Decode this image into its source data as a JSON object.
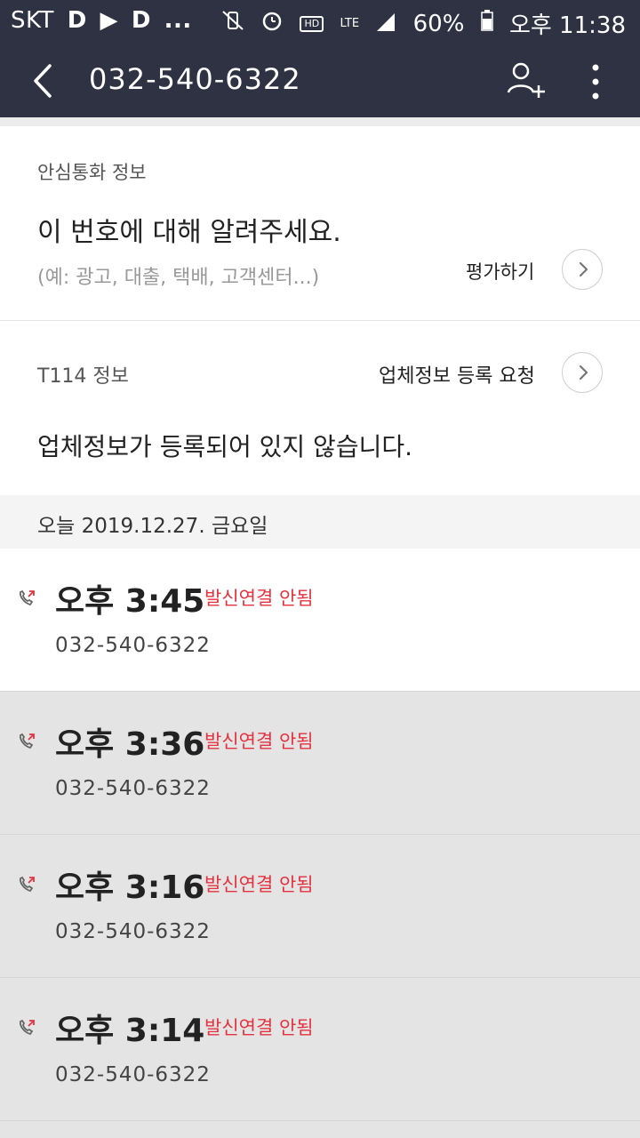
{
  "status_bar": {
    "carrier": "SKT",
    "notification_icons": [
      "D",
      "▶",
      "D",
      "..."
    ],
    "battery": "60%",
    "time": "오후 11:38",
    "hd_label": "HD",
    "lte_label": "LTE"
  },
  "app_bar": {
    "title": "032-540-6322",
    "icons": [
      "back-arrow-icon",
      "add-contact-icon",
      "more-vert-icon"
    ]
  },
  "safe_call": {
    "label": "안심통화 정보",
    "prompt": "이 번호에 대해 알려주세요.",
    "hint": "(예: 광고, 대출, 택배, 고객센터...)",
    "rate_label": "평가하기"
  },
  "t114": {
    "label": "T114 정보",
    "register_label": "업체정보 등록 요청",
    "message": "업체정보가 등록되어 있지 않습니다."
  },
  "date_header": "오늘 2019.12.27. 금요일",
  "calls": [
    {
      "time": "오후 3:45",
      "status": "발신연결 안됨",
      "number": "032-540-6322"
    },
    {
      "time": "오후 3:36",
      "status": "발신연결 안됨",
      "number": "032-540-6322"
    },
    {
      "time": "오후 3:16",
      "status": "발신연결 안됨",
      "number": "032-540-6322"
    },
    {
      "time": "오후 3:14",
      "status": "발신연결 안됨",
      "number": "032-540-6322"
    }
  ],
  "colors": {
    "header_bg": "#2f3242",
    "missed_red": "#e5323e",
    "row_gray": "#e4e4e4"
  }
}
